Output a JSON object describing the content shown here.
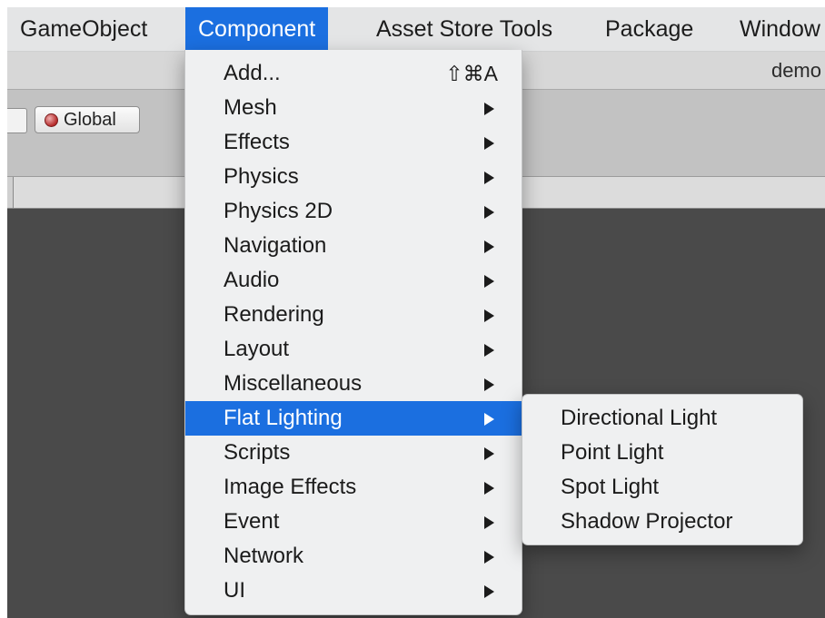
{
  "menubar": {
    "items": [
      {
        "label": "GameObject"
      },
      {
        "label": "Component"
      },
      {
        "label": "Asset Store Tools"
      },
      {
        "label": "Package"
      },
      {
        "label": "Window"
      }
    ],
    "active_index": 1
  },
  "window": {
    "title": "demo"
  },
  "toolbar": {
    "global_label": "Global",
    "global_icon": "globe-icon"
  },
  "component_menu": {
    "items": [
      {
        "label": "Add...",
        "shortcut": "⇧⌘A"
      },
      {
        "label": "Mesh"
      },
      {
        "label": "Effects"
      },
      {
        "label": "Physics"
      },
      {
        "label": "Physics 2D"
      },
      {
        "label": "Navigation"
      },
      {
        "label": "Audio"
      },
      {
        "label": "Rendering"
      },
      {
        "label": "Layout"
      },
      {
        "label": "Miscellaneous"
      },
      {
        "label": "Flat Lighting"
      },
      {
        "label": "Scripts"
      },
      {
        "label": "Image Effects"
      },
      {
        "label": "Event"
      },
      {
        "label": "Network"
      },
      {
        "label": "UI"
      }
    ],
    "highlighted_index": 10,
    "submenu_indicator_icon": "triangle-right-icon"
  },
  "flat_lighting_submenu": {
    "items": [
      {
        "label": "Directional Light"
      },
      {
        "label": "Point Light"
      },
      {
        "label": "Spot Light"
      },
      {
        "label": "Shadow Projector"
      }
    ]
  },
  "colors": {
    "highlight": "#1b6fe0",
    "menu_background": "#eff0f1",
    "menubar_background": "#e4e5e6",
    "scene_background": "#4a4a4a"
  }
}
